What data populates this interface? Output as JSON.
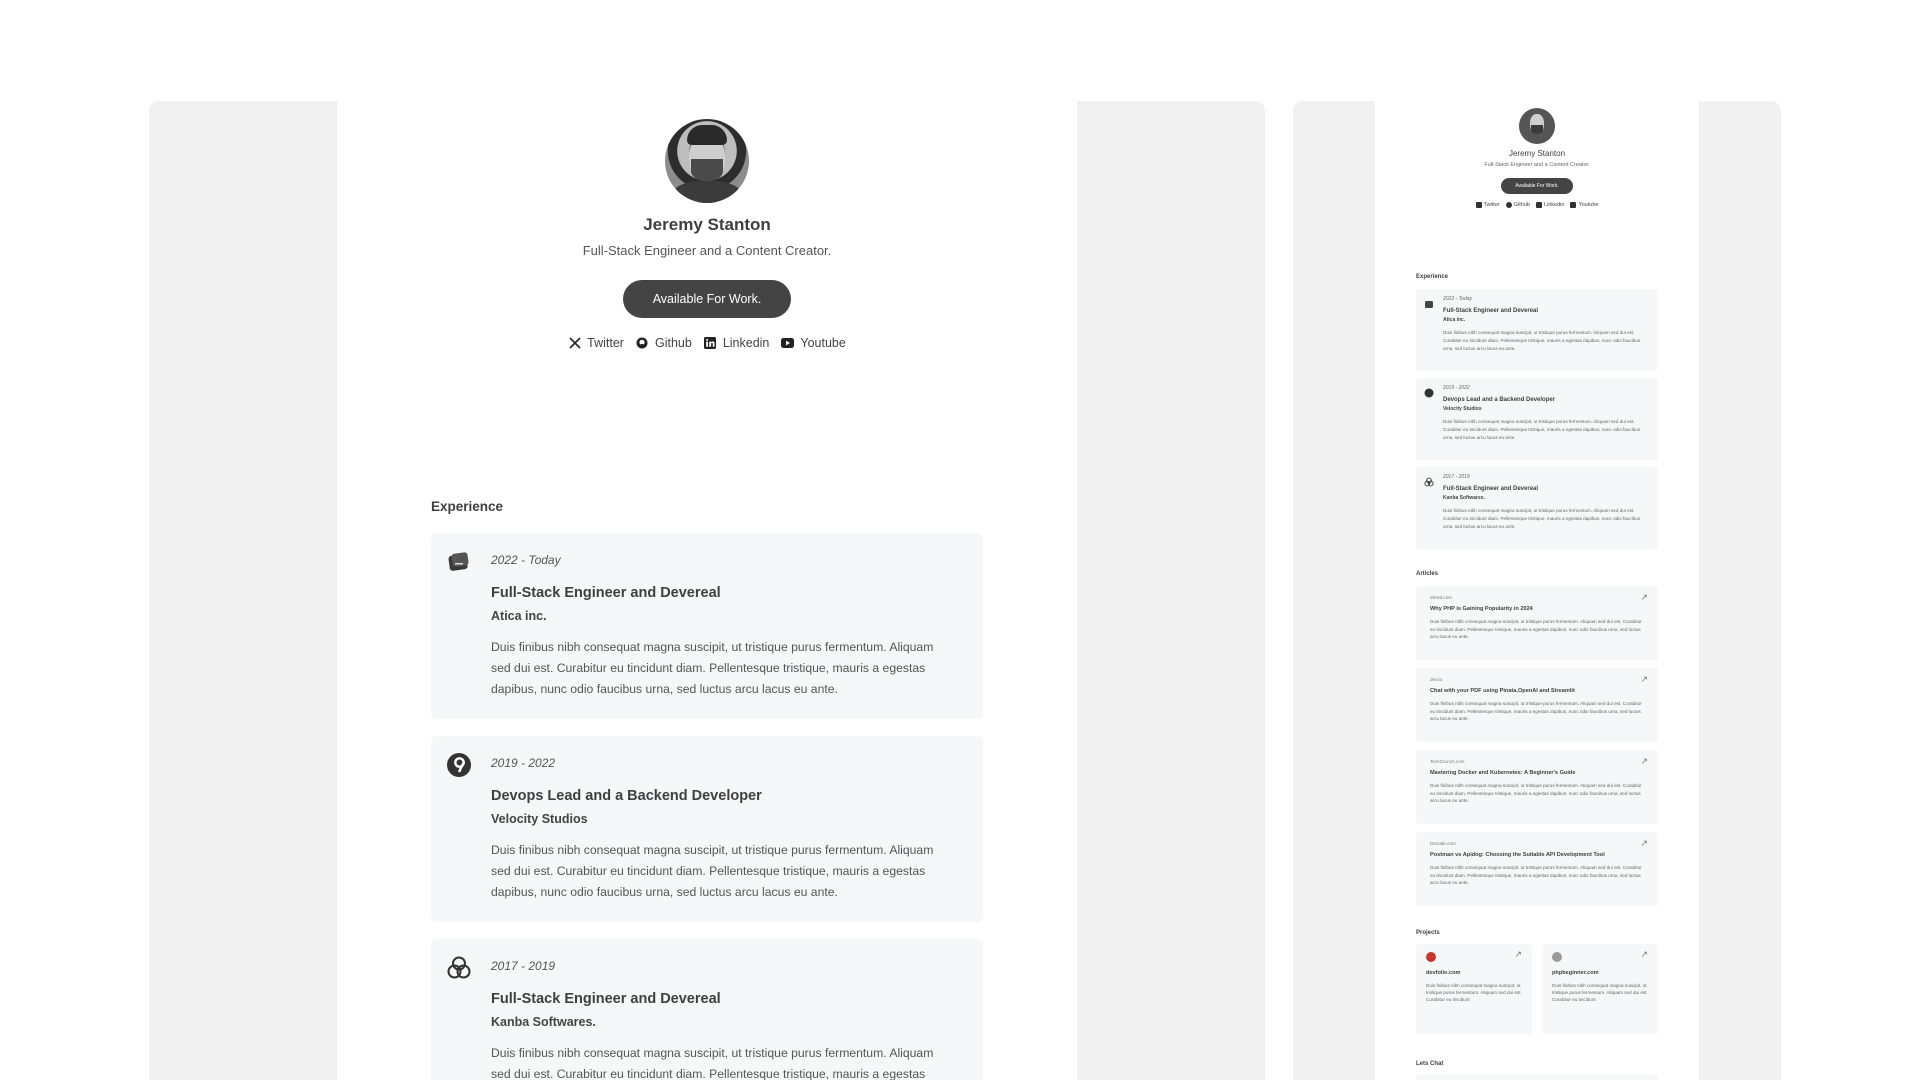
{
  "profile": {
    "name": "Jeremy Stanton",
    "tagline": "Full-Stack Engineer and a Content Creator.",
    "availability_label": "Available For Work.",
    "socials": [
      {
        "label": "Twitter",
        "icon": "x-icon"
      },
      {
        "label": "Github",
        "icon": "github-icon"
      },
      {
        "label": "Linkedin",
        "icon": "linkedin-icon"
      },
      {
        "label": "Youtube",
        "icon": "youtube-icon"
      }
    ]
  },
  "experience": {
    "title": "Experience",
    "items": [
      {
        "period": "2022 - Today",
        "role": "Full-Stack Engineer and Devereal",
        "company": "Atica inc.",
        "description": "Duis finibus nibh consequat magna suscipit, ut tristique purus  fermentum. Aliquam sed dui est. Curabitur eu tincidunt diam.  Pellentesque tristique, mauris a egestas dapibus, nunc odio faucibus  urna, sed luctus arcu lacus eu ante."
      },
      {
        "period": "2019 - 2022",
        "role": "Devops Lead and a Backend Developer",
        "company": "Velocity Studios",
        "description": "Duis finibus nibh consequat magna suscipit, ut tristique purus  fermentum. Aliquam sed dui est. Curabitur eu tincidunt diam.  Pellentesque tristique, mauris a egestas dapibus, nunc odio faucibus  urna, sed luctus arcu lacus eu ante."
      },
      {
        "period": "2017 - 2019",
        "role": "Full-Stack Engineer and Devereal",
        "company": "Kanba Softwares.",
        "description": "Duis finibus nibh consequat magna suscipit, ut tristique purus  fermentum. Aliquam sed dui est. Curabitur eu tincidunt diam.  Pellentesque tristique, mauris a egestas dapibus,"
      }
    ]
  },
  "mobile": {
    "experience": [
      {
        "period": "2022 - Today",
        "role": "Full-Stack Engineer and Devereal",
        "company": "Atica inc.",
        "description": "Duis finibus nibh consequat magna suscipit, ut tristique purus  fermentum. Aliquam sed dui est. Curabitur eu tincidunt diam.  Pellentesque tristique, mauris a egestas dapibus, nunc odio faucibus  urna, sed luctus arcu lacus eu ante."
      },
      {
        "period": "2019 - 2022",
        "role": "Devops Lead and a Backend Developer",
        "company": "Velocity Studios",
        "description": "Duis finibus nibh consequat magna suscipit, ut tristique purus  fermentum. Aliquam sed dui est. Curabitur eu tincidunt diam.  Pellentesque tristique, mauris a egestas dapibus, nunc odio faucibus  urna, sed luctus arcu lacus eu ante."
      },
      {
        "period": "2017 - 2019",
        "role": "Full-Stack Engineer and Devereal",
        "company": "Kanba Softwares.",
        "description": "Duis finibus nibh consequat magna suscipit, ut tristique purus  fermentum. Aliquam sed dui est. Curabitur eu tincidunt diam.  Pellentesque tristique, mauris a egestas dapibus, nunc odio faucibus  urna, sed luctus arcu lacus eu ante."
      }
    ],
    "articles_title": "Articles",
    "articles": [
      {
        "source": "Wired.com",
        "title": "Why PHP is Gaining Popularity in 2024",
        "description": "Duis finibus nibh consequat magna suscipit, ut tristique purus  fermentum. Aliquam sed dui est. Curabitur eu tincidunt diam.  Pellentesque tristique, mauris a egestas dapibus, nunc odio faucibus  urna, sed luctus arcu lacus eu ante."
      },
      {
        "source": "dev.to",
        "title": "Chat with your PDF using Pinata,OpenAI and Streamlit",
        "description": "Duis finibus nibh consequat magna suscipit, ut tristique purus  fermentum. Aliquam sed dui est. Curabitur eu tincidunt diam.  Pellentesque tristique, mauris a egestas dapibus, nunc odio faucibus  urna, sed luctus arcu lacus eu ante."
      },
      {
        "source": "TechCrunch.com",
        "title": "Mastering Docker and Kubernetes: A Beginner's Guide",
        "description": "Duis finibus nibh consequat magna suscipit, ut tristique purus  fermentum. Aliquam sed dui est. Curabitur eu tincidunt diam.  Pellentesque tristique, mauris a egestas dapibus, nunc odio faucibus  urna, sed luctus arcu lacus eu ante."
      },
      {
        "source": "Decode.com",
        "title": "Postman vs Apidog: Choosing the Suitable API Development Tool",
        "description": "Duis finibus nibh consequat magna suscipit, ut tristique purus  fermentum. Aliquam sed dui est. Curabitur eu tincidunt diam.  Pellentesque tristique, mauris a egestas dapibus, nunc odio faucibus  urna, sed luctus arcu lacus eu ante."
      }
    ],
    "projects_title": "Projects",
    "projects": [
      {
        "name": "devfolio.com",
        "description": "Duis finibus nibh consequat magna suscipit, ut tristique purus fermentum. Aliquam sed dui est. Curabitur eu tincidunt",
        "accent": "#c0392b"
      },
      {
        "name": "phpbeginner.com",
        "description": "Duis finibus nibh consequat magna suscipit, ut tristique purus fermentum. Aliquam sed dui est. Curabitur eu tincidunt",
        "accent": "#9a9a9a"
      }
    ],
    "chat_title": "Lets Chat"
  },
  "colors": {
    "button_bg": "#444444",
    "card_bg": "#f6f7f9",
    "frame_bg": "#f1f1f1"
  }
}
